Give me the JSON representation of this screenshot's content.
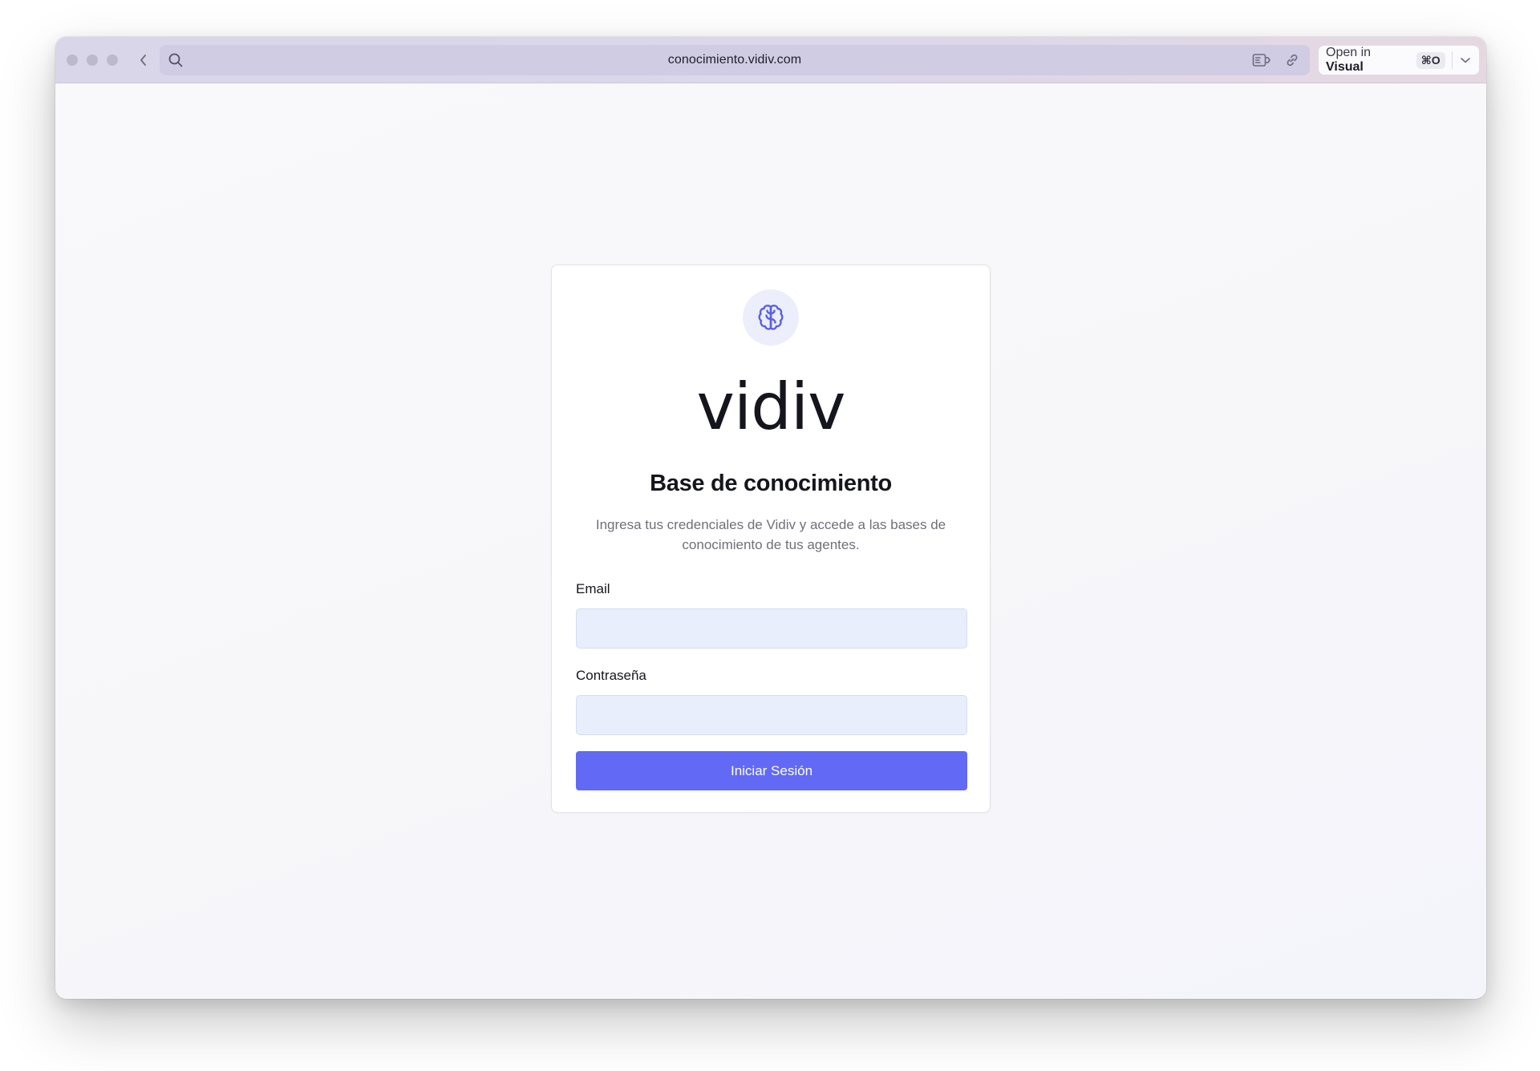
{
  "browser": {
    "url": "conocimiento.vidiv.com",
    "open_in_prefix": "Open in",
    "open_in_app": "Visual",
    "open_in_shortcut": "⌘O",
    "icons": {
      "back": "chevron-left-icon",
      "search": "search-icon",
      "reader": "reader-mode-icon",
      "link": "link-icon",
      "dropdown": "chevron-down-icon"
    }
  },
  "login": {
    "logo_icon": "brain-icon",
    "wordmark": "vidiv",
    "title": "Base de conocimiento",
    "subtitle": "Ingresa tus credenciales de Vidiv y accede a las bases de conocimiento de tus agentes.",
    "email_label": "Email",
    "email_value": "",
    "password_label": "Contraseña",
    "password_value": "",
    "submit_label": "Iniciar Sesión"
  },
  "colors": {
    "accent": "#6269f5",
    "input_bg": "#e9eefc",
    "logo_bg": "#eceefb",
    "logo_stroke": "#5a61e6"
  }
}
